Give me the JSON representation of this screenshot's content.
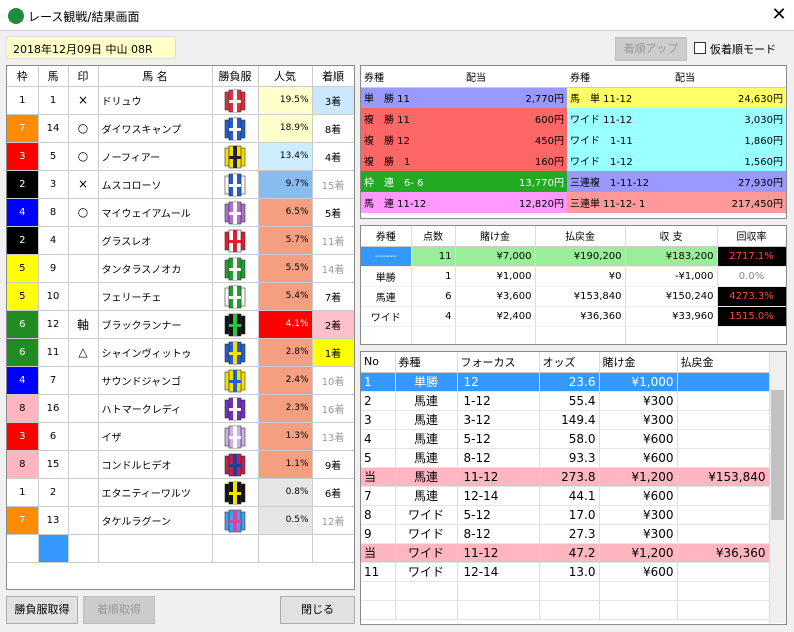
{
  "window": {
    "title": "レース観戦/結果画面",
    "close": "✕"
  },
  "race_info": "2018年12月09日 中山 08R",
  "buttons": {
    "rank_up": "着順アップ",
    "temp_mode": "仮着順モード",
    "get_silks": "勝負服取得",
    "get_rank": "着順取得",
    "close": "閉じる"
  },
  "horses": {
    "headers": [
      "枠",
      "馬",
      "印",
      "馬 名",
      "勝負服",
      "人気",
      "着順"
    ],
    "rows": [
      {
        "waku": "1",
        "uma": "1",
        "mark": "×",
        "name": "ドリュウ",
        "pop": "19.5%",
        "rank": "3着",
        "wc": "#ffffff",
        "wt": "#000",
        "pc": "#ffffcc",
        "rc": "#cce8ff",
        "rt": "#000",
        "silk": [
          "#e03040",
          "#ffffff",
          "#e03040"
        ]
      },
      {
        "waku": "7",
        "uma": "14",
        "mark": "○",
        "name": "ダイワスキャンプ",
        "pop": "18.9%",
        "rank": "8着",
        "wc": "#ff8c00",
        "wt": "#fff",
        "pc": "#ffffcc",
        "rc": "#fff",
        "rt": "#000",
        "silk": [
          "#1f5fd0",
          "#ffffff",
          "#1f5fd0"
        ]
      },
      {
        "waku": "3",
        "uma": "5",
        "mark": "○",
        "name": "ノーフィアー",
        "pop": "13.4%",
        "rank": "4着",
        "wc": "#ff0000",
        "wt": "#fff",
        "pc": "#cceeff",
        "rc": "#fff",
        "rt": "#000",
        "silk": [
          "#f5e000",
          "#222222",
          "#f5e000"
        ]
      },
      {
        "waku": "2",
        "uma": "3",
        "mark": "×",
        "name": "ムスコローソ",
        "pop": "9.7%",
        "rank": "15着",
        "wc": "#000000",
        "wt": "#fff",
        "pc": "#88bbee",
        "rc": "#fff",
        "rt": "#999",
        "silk": [
          "#1f5fd0",
          "#ffffff",
          "#ffffff"
        ]
      },
      {
        "waku": "4",
        "uma": "8",
        "mark": "○",
        "name": "マイウェイアムール",
        "pop": "6.5%",
        "rank": "5着",
        "wc": "#0000ff",
        "wt": "#fff",
        "pc": "#f4a080",
        "rc": "#fff",
        "rt": "#000",
        "silk": [
          "#b070d0",
          "#ffffff",
          "#b070d0"
        ]
      },
      {
        "waku": "2",
        "uma": "4",
        "mark": "",
        "name": "グラスレオ",
        "pop": "5.7%",
        "rank": "11着",
        "wc": "#000000",
        "wt": "#fff",
        "pc": "#f4a080",
        "rc": "#fff",
        "rt": "#999",
        "silk": [
          "#ffffff",
          "#e02030",
          "#e02030"
        ]
      },
      {
        "waku": "5",
        "uma": "9",
        "mark": "",
        "name": "タンタラスノオカ",
        "pop": "5.5%",
        "rank": "14着",
        "wc": "#ffff00",
        "wt": "#000",
        "pc": "#f4a080",
        "rc": "#fff",
        "rt": "#999",
        "silk": [
          "#20a030",
          "#ffffff",
          "#20a030"
        ]
      },
      {
        "waku": "5",
        "uma": "10",
        "mark": "",
        "name": "フェリーチェ",
        "pop": "5.4%",
        "rank": "7着",
        "wc": "#ffff00",
        "wt": "#000",
        "pc": "#f4a080",
        "rc": "#fff",
        "rt": "#000",
        "silk": [
          "#20a030",
          "#ffffff",
          "#ffffff"
        ]
      },
      {
        "waku": "6",
        "uma": "12",
        "mark": "軸",
        "name": "ブラックランナー",
        "pop": "4.1%",
        "rank": "2着",
        "wc": "#228b22",
        "wt": "#fff",
        "pc": "#ff0000",
        "rc": "#ffc0cb",
        "rt": "#000",
        "silk": [
          "#111111",
          "#30c040",
          "#111111"
        ]
      },
      {
        "waku": "6",
        "uma": "11",
        "mark": "△",
        "name": "シャインヴィットゥ",
        "pop": "2.8%",
        "rank": "1着",
        "wc": "#228b22",
        "wt": "#fff",
        "pc": "#f4a080",
        "rc": "#ffff00",
        "rt": "#000",
        "silk": [
          "#1f5fd0",
          "#f5e000",
          "#1f5fd0"
        ]
      },
      {
        "waku": "4",
        "uma": "7",
        "mark": "",
        "name": "サウンドジャンゴ",
        "pop": "2.4%",
        "rank": "10着",
        "wc": "#0000ff",
        "wt": "#fff",
        "pc": "#f4a080",
        "rc": "#fff",
        "rt": "#999",
        "silk": [
          "#f5e000",
          "#1f5fd0",
          "#f5e000"
        ]
      },
      {
        "waku": "8",
        "uma": "16",
        "mark": "",
        "name": "ハトマークレディ",
        "pop": "2.3%",
        "rank": "16着",
        "wc": "#ffb6c1",
        "wt": "#000",
        "pc": "#f4a080",
        "rc": "#fff",
        "rt": "#999",
        "silk": [
          "#7030c0",
          "#ffffff",
          "#7030c0"
        ]
      },
      {
        "waku": "3",
        "uma": "6",
        "mark": "",
        "name": "イザ",
        "pop": "1.3%",
        "rank": "13着",
        "wc": "#ff0000",
        "wt": "#fff",
        "pc": "#f4a080",
        "rc": "#fff",
        "rt": "#999",
        "silk": [
          "#d0b0e8",
          "#ffffff",
          "#d0b0e8"
        ]
      },
      {
        "waku": "8",
        "uma": "15",
        "mark": "",
        "name": "コンドルヒデオ",
        "pop": "1.1%",
        "rank": "9着",
        "wc": "#ffb6c1",
        "wt": "#000",
        "pc": "#f4a080",
        "rc": "#fff",
        "rt": "#000",
        "silk": [
          "#c02050",
          "#1f3fa0",
          "#c02050"
        ]
      },
      {
        "waku": "1",
        "uma": "2",
        "mark": "",
        "name": "エタニティーワルツ",
        "pop": "0.8%",
        "rank": "6着",
        "wc": "#ffffff",
        "wt": "#000",
        "pc": "#e6e6e6",
        "rc": "#fff",
        "rt": "#000",
        "silk": [
          "#111111",
          "#f5e000",
          "#111111"
        ]
      },
      {
        "waku": "7",
        "uma": "13",
        "mark": "",
        "name": "タケルラグーン",
        "pop": "0.5%",
        "rank": "12着",
        "wc": "#ff8c00",
        "wt": "#fff",
        "pc": "#e6e6e6",
        "rc": "#fff",
        "rt": "#999",
        "silk": [
          "#40a0f0",
          "#e040a0",
          "#40a0f0"
        ]
      }
    ]
  },
  "payouts": {
    "headers": [
      "券種",
      "配当",
      "券種",
      "配当"
    ],
    "rows": [
      {
        "t1": "単　勝 11",
        "p1": "2,770円",
        "c1": "#9999ff",
        "t2": "馬　単 11-12",
        "p2": "24,630円",
        "c2": "#ffff66"
      },
      {
        "t1": "複　勝 11",
        "p1": "600円",
        "c1": "#ff6666",
        "t2": "ワイド 11-12",
        "p2": "3,030円",
        "c2": "#99ffff"
      },
      {
        "t1": "複　勝 12",
        "p1": "450円",
        "c1": "#ff6666",
        "t2": "ワイド　1-11",
        "p2": "1,860円",
        "c2": "#99ffff"
      },
      {
        "t1": "複　勝　1",
        "p1": "160円",
        "c1": "#ff6666",
        "t2": "ワイド　1-12",
        "p2": "1,560円",
        "c2": "#99ffff"
      },
      {
        "t1": "枠　連　6- 6",
        "p1": "13,770円",
        "c1": "#22aa22",
        "t2": "三連複　1-11-12",
        "p2": "27,930円",
        "c2": "#9999ff"
      },
      {
        "t1": "馬　連 11-12",
        "p1": "12,820円",
        "c1": "#ff99ff",
        "t2": "三連単 11-12- 1",
        "p2": "217,450円",
        "c2": "#ff9999"
      }
    ]
  },
  "summary": {
    "headers": [
      "券種",
      "点数",
      "賭け金",
      "払戻金",
      "収 支",
      "回収率"
    ],
    "rows": [
      {
        "type": "------",
        "count": "11",
        "bet": "¥7,000",
        "ret": "¥190,200",
        "bal": "¥183,200",
        "rate": "2717.1%",
        "bg": "#99ee99",
        "ratebg": "#000",
        "ratec": "#ff4444",
        "tbg": "#3399ff",
        "tc": "#fff"
      },
      {
        "type": "単勝",
        "count": "1",
        "bet": "¥1,000",
        "ret": "¥0",
        "bal": "-¥1,000",
        "rate": "0.0%",
        "bg": "#fff",
        "ratebg": "#fff",
        "ratec": "#888",
        "tbg": "#fff",
        "tc": "#000"
      },
      {
        "type": "馬連",
        "count": "6",
        "bet": "¥3,600",
        "ret": "¥153,840",
        "bal": "¥150,240",
        "rate": "4273.3%",
        "bg": "#fff",
        "ratebg": "#000",
        "ratec": "#ff4444",
        "tbg": "#fff",
        "tc": "#000"
      },
      {
        "type": "ワイド",
        "count": "4",
        "bet": "¥2,400",
        "ret": "¥36,360",
        "bal": "¥33,960",
        "rate": "1515.0%",
        "bg": "#fff",
        "ratebg": "#000",
        "ratec": "#ff4444",
        "tbg": "#fff",
        "tc": "#000"
      }
    ]
  },
  "bets": {
    "headers": [
      "No",
      "券種",
      "フォーカス",
      "オッズ",
      "賭け金",
      "払戻金"
    ],
    "rows": [
      {
        "no": "1",
        "type": "単勝",
        "focus": "12",
        "odds": "23.6",
        "bet": "¥1,000",
        "ret": "",
        "style": "sel"
      },
      {
        "no": "2",
        "type": "馬連",
        "focus": "1-12",
        "odds": "55.4",
        "bet": "¥300",
        "ret": "",
        "style": ""
      },
      {
        "no": "3",
        "type": "馬連",
        "focus": "3-12",
        "odds": "149.4",
        "bet": "¥300",
        "ret": "",
        "style": ""
      },
      {
        "no": "4",
        "type": "馬連",
        "focus": "5-12",
        "odds": "58.0",
        "bet": "¥600",
        "ret": "",
        "style": ""
      },
      {
        "no": "5",
        "type": "馬連",
        "focus": "8-12",
        "odds": "93.3",
        "bet": "¥600",
        "ret": "",
        "style": ""
      },
      {
        "no": "当",
        "type": "馬連",
        "focus": "11-12",
        "odds": "273.8",
        "bet": "¥1,200",
        "ret": "¥153,840",
        "style": "hit"
      },
      {
        "no": "7",
        "type": "馬連",
        "focus": "12-14",
        "odds": "44.1",
        "bet": "¥600",
        "ret": "",
        "style": ""
      },
      {
        "no": "8",
        "type": "ワイド",
        "focus": "5-12",
        "odds": "17.0",
        "bet": "¥300",
        "ret": "",
        "style": ""
      },
      {
        "no": "9",
        "type": "ワイド",
        "focus": "8-12",
        "odds": "27.3",
        "bet": "¥300",
        "ret": "",
        "style": ""
      },
      {
        "no": "当",
        "type": "ワイド",
        "focus": "11-12",
        "odds": "47.2",
        "bet": "¥1,200",
        "ret": "¥36,360",
        "style": "hit"
      },
      {
        "no": "11",
        "type": "ワイド",
        "focus": "12-14",
        "odds": "13.0",
        "bet": "¥600",
        "ret": "",
        "style": ""
      }
    ]
  }
}
